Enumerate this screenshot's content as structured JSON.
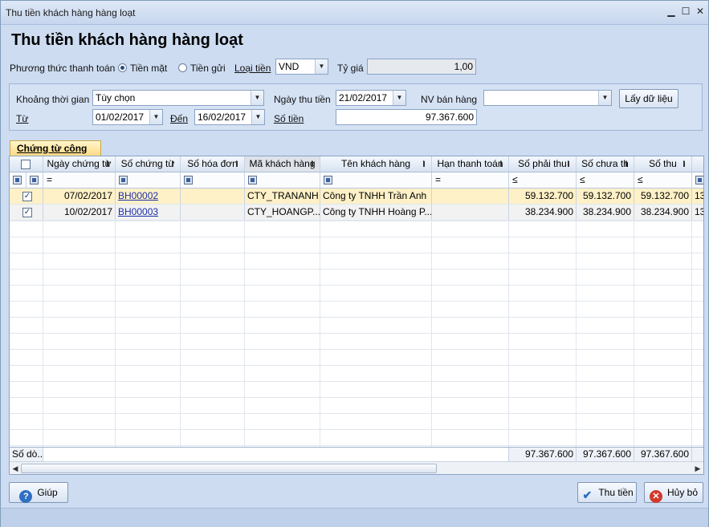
{
  "window": {
    "title": "Thu tiền khách hàng hàng loạt"
  },
  "heading": "Thu tiền khách hàng hàng loạt",
  "payment": {
    "method_label": "Phương thức thanh toán",
    "cash_label": "Tiền mặt",
    "bank_label": "Tiền gửi",
    "currency_label": "Loại tiền",
    "currency_value": "VND",
    "rate_label": "Tỷ giá",
    "rate_value": "1,00"
  },
  "filter": {
    "period_label": "Khoảng thời gian",
    "period_value": "Tùy chọn",
    "receipt_date_label": "Ngày thu tiền",
    "receipt_date_value": "21/02/2017",
    "sales_staff_label": "NV bán hàng",
    "sales_staff_value": "",
    "get_data_button": "Lấy dữ liệu",
    "from_label": "Từ",
    "from_value": "01/02/2017",
    "to_label": "Đến",
    "to_value": "16/02/2017",
    "amount_label": "Số tiền",
    "amount_value": "97.367.600"
  },
  "tab": {
    "label": "Chứng từ công nợ"
  },
  "grid": {
    "columns": [
      "Ngày chứng từ",
      "Số chứng từ",
      "Số hóa đơn",
      "Mã khách hàng",
      "Tên khách hàng",
      "Hạn thanh toán",
      "Số phải thu",
      "Số chưa th",
      "Số thu"
    ],
    "filter_ops": {
      "date": "=",
      "due": "=",
      "receivable": "≤",
      "unpaid": "≤",
      "paid": "≤"
    },
    "rows": [
      {
        "checked": "✓",
        "date": "07/02/2017",
        "voucher": "BH00002",
        "invoice": "",
        "customer_code": "CTY_TRANANH",
        "customer_name": "Công ty TNHH Trần Anh",
        "due": "",
        "receivable": "59.132.700",
        "unpaid": "59.132.700",
        "paid": "59.132.700",
        "extra": "13"
      },
      {
        "checked": "✓",
        "date": "10/02/2017",
        "voucher": "BH00003",
        "invoice": "",
        "customer_code": "CTY_HOANGP...",
        "customer_name": "Công ty TNHH Hoàng P...",
        "due": "",
        "receivable": "38.234.900",
        "unpaid": "38.234.900",
        "paid": "38.234.900",
        "extra": "13"
      }
    ],
    "footer": {
      "count_label": "Số dò...",
      "receivable_total": "97.367.600",
      "unpaid_total": "97.367.600",
      "paid_total": "97.367.600"
    }
  },
  "buttons": {
    "help": "Giúp",
    "collect": "Thu tiền",
    "cancel": "Hủy bỏ"
  },
  "colors": {
    "selected_row": "#fff1c7",
    "tab": "#ffd982",
    "link": "#1d2fa8"
  }
}
